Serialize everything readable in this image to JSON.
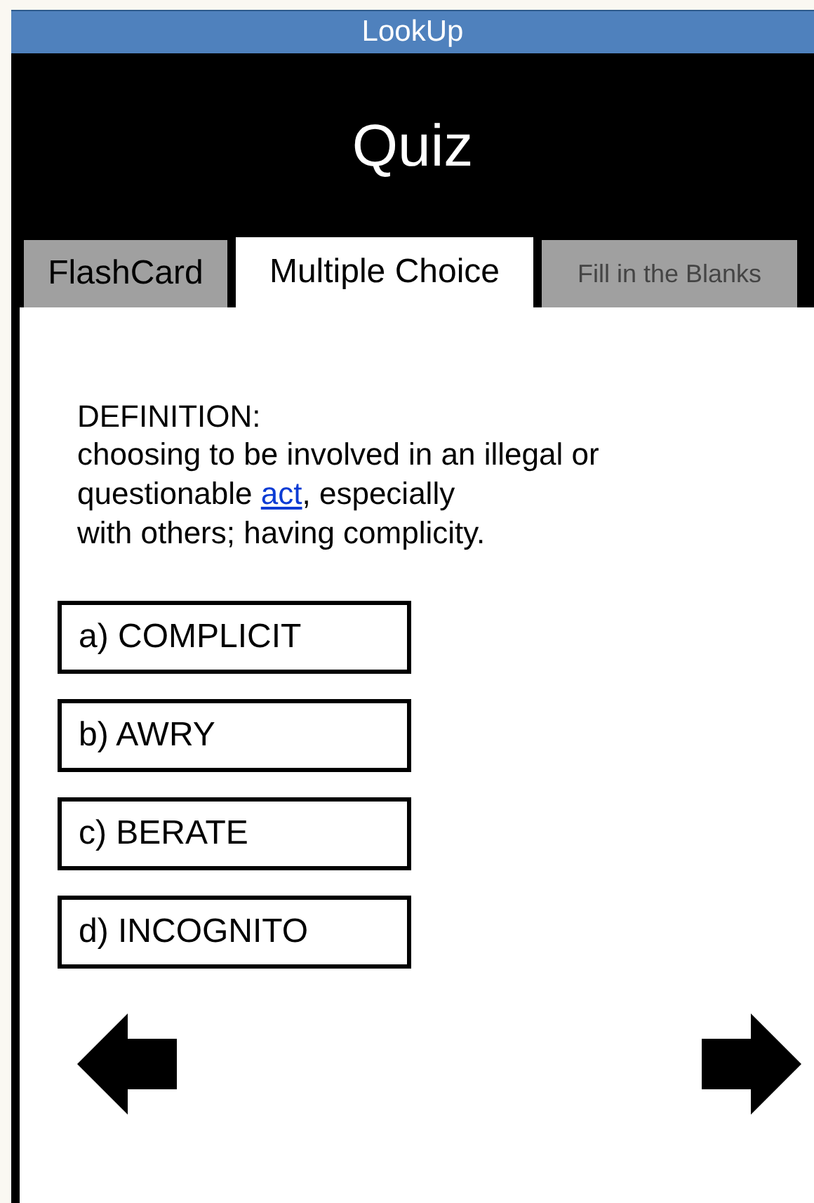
{
  "window": {
    "title": "LookUp"
  },
  "header": {
    "title": "Quiz"
  },
  "tabs": [
    {
      "label": "FlashCard",
      "selected": false,
      "disabled": false
    },
    {
      "label": "Multiple Choice",
      "selected": true,
      "disabled": false
    },
    {
      "label": "Fill in the Blanks",
      "selected": false,
      "disabled": true
    }
  ],
  "definition": {
    "label": "DEFINITION:",
    "text_before": "choosing to be involved in an illegal or\nquestionable ",
    "link": "act",
    "text_after": ", especially\nwith others; having complicity."
  },
  "choices": [
    {
      "label": "a) COMPLICIT"
    },
    {
      "label": "b) AWRY"
    },
    {
      "label": "c) BERATE"
    },
    {
      "label": "d) INCOGNITO"
    }
  ]
}
